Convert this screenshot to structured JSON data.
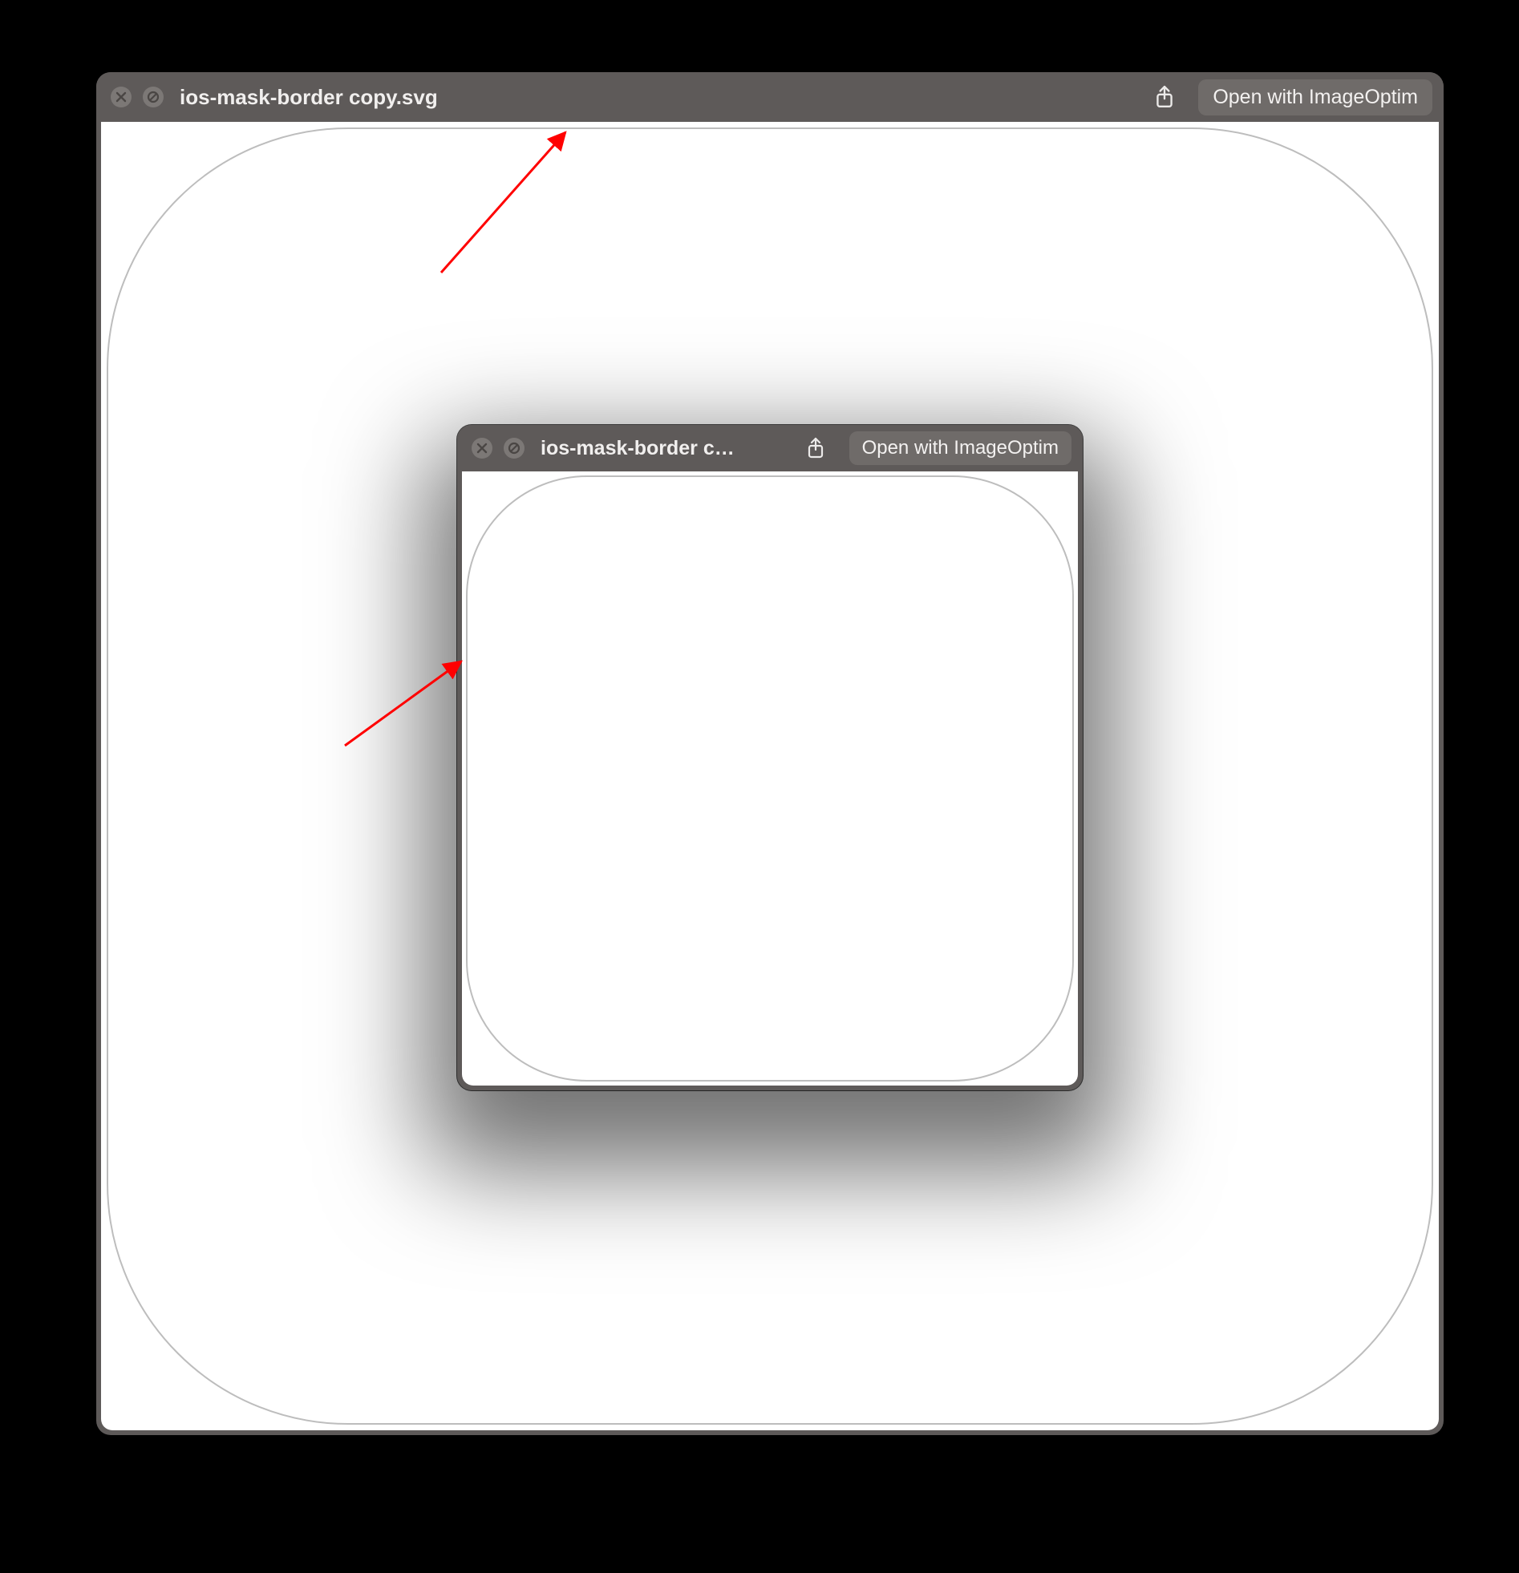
{
  "windows": {
    "back": {
      "title": "ios-mask-border copy.svg",
      "open_with_label": "Open with ImageOptim"
    },
    "front": {
      "title": "ios-mask-border c…",
      "open_with_label": "Open with ImageOptim"
    }
  },
  "icons": {
    "close": "close-icon",
    "disabled": "disabled-icon",
    "share": "share-icon"
  },
  "annotation": {
    "arrow_color": "#ff0000"
  }
}
